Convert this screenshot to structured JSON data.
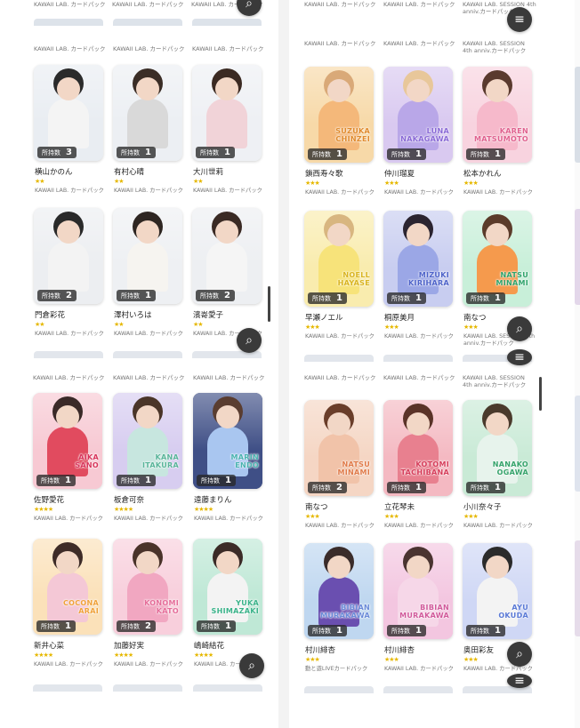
{
  "labels": {
    "pack_kawaii": "KAWAII LAB. カードパック",
    "pack_session_line1": "KAWAII LAB. SESSION 4th",
    "pack_session_line2": "anniv.カードパック",
    "pack_live": "動と遊LIVEカードパック",
    "owned": "所持数"
  },
  "icons": {
    "search": "search-icon",
    "filter": "filter-icon"
  },
  "panels": [
    {
      "id": "top-left",
      "top_pack": "KAWAII LAB. カードパック",
      "cards": [
        {
          "name": "横山かのん",
          "count": "3",
          "stars": "★★",
          "pack": "KAWAII LAB. カードパック",
          "bg": "#e9edf2",
          "hair": "#2b2b2b",
          "outfit": "#f4f4f4",
          "overlay": ""
        },
        {
          "name": "有村心晴",
          "count": "1",
          "stars": "★★",
          "pack": "KAWAII LAB. カードパック",
          "bg": "#eceff3",
          "hair": "#3a2d26",
          "outfit": "#d9d9d9",
          "overlay": ""
        },
        {
          "name": "大川世莉",
          "count": "1",
          "stars": "★★",
          "pack": "KAWAII LAB. カードパック",
          "bg": "#eef0f4",
          "hair": "#3b2a22",
          "outfit": "#f1d3d8",
          "overlay": ""
        },
        {
          "name": "門倉彩花",
          "count": "2",
          "stars": "★★",
          "pack": "KAWAII LAB. カードパック",
          "bg": "#eceef1",
          "hair": "#2a2a2a",
          "outfit": "#f3f3f3",
          "overlay": ""
        },
        {
          "name": "澤村いろは",
          "count": "1",
          "stars": "★★",
          "pack": "KAWAII LAB. カードパック",
          "bg": "#eef0f3",
          "hair": "#2e2622",
          "outfit": "#f6f4f0",
          "overlay": ""
        },
        {
          "name": "濱嵜愛子",
          "count": "2",
          "stars": "★★",
          "pack": "KAWAII LAB. カードパック",
          "bg": "#edeff2",
          "hair": "#3a2a24",
          "outfit": "#f5f5f5",
          "overlay": ""
        }
      ]
    },
    {
      "id": "top-right",
      "top_pack": "KAWAII LAB. SESSION 4th anniv.カードパック",
      "cards": [
        {
          "name": "鎖西寿々歌",
          "count": "1",
          "stars": "★★★",
          "pack": "KAWAII LAB. カードパック",
          "bg": "#f7d9a8",
          "hair": "#d9a978",
          "outfit": "#f4b87a",
          "overlay": "SUZUKA\nCHINZEI",
          "ocolor": "#e08a2c"
        },
        {
          "name": "仲川瑠夏",
          "count": "1",
          "stars": "★★★",
          "pack": "KAWAII LAB. カードパック",
          "bg": "#d9c9f0",
          "hair": "#e8c79a",
          "outfit": "#b9a7e8",
          "overlay": "LUNA\nNAKAGAWA",
          "ocolor": "#8a6ad6"
        },
        {
          "name": "松本かれん",
          "count": "1",
          "stars": "★★★",
          "pack": "KAWAII LAB. カードパック",
          "bg": "#f8d3df",
          "hair": "#5a3a2e",
          "outfit": "#f6b9cb",
          "overlay": "KAREN\nMATSUMOTO",
          "ocolor": "#e0628f"
        },
        {
          "name": "早瀬ノエル",
          "count": "1",
          "stars": "★★★",
          "pack": "KAWAII LAB. カードパック",
          "bg": "#f9ecae",
          "hair": "#d8b680",
          "outfit": "#f7e37a",
          "overlay": "NOELL\nHAYASE",
          "ocolor": "#d9b420"
        },
        {
          "name": "桐原美月",
          "count": "1",
          "stars": "★★★",
          "pack": "KAWAII LAB. カードパック",
          "bg": "#c8cdf0",
          "hair": "#2b2430",
          "outfit": "#9ba7e6",
          "overlay": "MIZUKI\nKIRIHARA",
          "ocolor": "#4e63c9"
        },
        {
          "name": "南なつ",
          "count": "1",
          "stars": "★★★",
          "pack": "KAWAII LAB. SESSION 4th anniv.カードパック",
          "bg": "#c8efd9",
          "hair": "#5b3b2a",
          "outfit": "#f59a4d",
          "overlay": "NATSU\nMINAMI",
          "ocolor": "#2fa36b"
        }
      ]
    },
    {
      "id": "bottom-left",
      "top_pack": "KAWAII LAB. カードパック",
      "cards": [
        {
          "name": "佐野愛花",
          "count": "1",
          "stars": "★★★★",
          "pack": "KAWAII LAB. カードパック",
          "bg": "#f7c9d3",
          "hair": "#3a2a28",
          "outfit": "#e14b5f",
          "overlay": "AIKA\nSANO",
          "ocolor": "#d8355b"
        },
        {
          "name": "板倉可奈",
          "count": "1",
          "stars": "★★★★",
          "pack": "KAWAII LAB. カードパック",
          "bg": "#d7cdf0",
          "hair": "#4a3528",
          "outfit": "#c7e6df",
          "overlay": "KANA\nITAKURA",
          "ocolor": "#5ab59a"
        },
        {
          "name": "遠藤まりん",
          "count": "1",
          "stars": "★★★★",
          "pack": "KAWAII LAB. カードパック",
          "bg": "#3f4f86",
          "hair": "#5a3d30",
          "outfit": "#a9c6f0",
          "overlay": "MARIN\nENDO",
          "ocolor": "#4ab3b0"
        },
        {
          "name": "新井心菜",
          "count": "1",
          "stars": "★★★★",
          "pack": "KAWAII LAB. カードパック",
          "bg": "#fbe1b9",
          "hair": "#3e2c28",
          "outfit": "#f4c8d6",
          "overlay": "COCONA\nARAI",
          "ocolor": "#f0a23a"
        },
        {
          "name": "加藤好実",
          "count": "2",
          "stars": "★★★★",
          "pack": "KAWAII LAB. カードパック",
          "bg": "#f8cfdc",
          "hair": "#4a332a",
          "outfit": "#f1a7c1",
          "overlay": "KONOMI\nKATO",
          "ocolor": "#e56d99"
        },
        {
          "name": "嶋崎結花",
          "count": "1",
          "stars": "★★★★",
          "pack": "KAWAII LAB. カードパック",
          "bg": "#bfe8d6",
          "hair": "#3b2b27",
          "outfit": "#f3f3f3",
          "overlay": "YUKA\nSHIMAZAKI",
          "ocolor": "#3bb38a"
        }
      ]
    },
    {
      "id": "bottom-right",
      "top_pack": "KAWAII LAB. SESSION 4th anniv.カードパック",
      "cards": [
        {
          "name": "南なつ",
          "count": "2",
          "stars": "★★★",
          "pack": "KAWAII LAB. カードパック",
          "bg": "#f5d6c4",
          "hair": "#6a3e2a",
          "outfit": "#f1c3a9",
          "overlay": "NATSU\nMINAMI",
          "ocolor": "#e07b4a"
        },
        {
          "name": "立花琴未",
          "count": "1",
          "stars": "★★★",
          "pack": "KAWAII LAB. カードパック",
          "bg": "#f4b9c2",
          "hair": "#5a3328",
          "outfit": "#e8808f",
          "overlay": "KOTOMI\nTACHIBANA",
          "ocolor": "#d63d5a"
        },
        {
          "name": "小川奈々子",
          "count": "1",
          "stars": "★★★",
          "pack": "KAWAII LAB. カードパック",
          "bg": "#c9ead6",
          "hair": "#4a3a2c",
          "outfit": "#e7f3ec",
          "overlay": "NANAKO\nOGAWA",
          "ocolor": "#36a36b"
        },
        {
          "name": "村川緋杏",
          "count": "1",
          "stars": "★★★",
          "pack": "動と遊LIVEカードパック",
          "bg": "#bfd7f0",
          "hair": "#3a2c2a",
          "outfit": "#6a4fb0",
          "overlay": "BIBIAN\nMURAKAWA",
          "ocolor": "#6a8ad8"
        },
        {
          "name": "村川緋杏",
          "count": "1",
          "stars": "★★★",
          "pack": "KAWAII LAB. カードパック",
          "bg": "#f3c6e0",
          "hair": "#4a3430",
          "outfit": "#f6d7e8",
          "overlay": "BIBIAN\nMURAKAWA",
          "ocolor": "#d15a9b"
        },
        {
          "name": "奥田彩友",
          "count": "1",
          "stars": "★★★",
          "pack": "KAWAII LAB. カードパック",
          "bg": "#cfd7f5",
          "hair": "#2b2b2b",
          "outfit": "#f3f3f3",
          "overlay": "AYU\nOKUDA",
          "ocolor": "#5b7ad6"
        }
      ]
    }
  ]
}
